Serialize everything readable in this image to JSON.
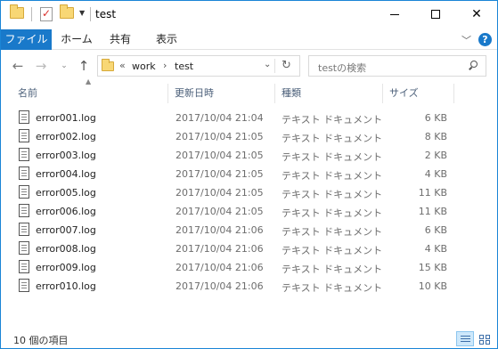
{
  "window": {
    "title": "test",
    "controls": {
      "minimize": "minimize",
      "maximize": "maximize",
      "close": "✕"
    }
  },
  "ribbon": {
    "tabs": [
      "ファイル",
      "ホーム",
      "共有",
      "表示"
    ],
    "expand_icon": "chevron-down-icon",
    "help": "?"
  },
  "address": {
    "overflow": "«",
    "crumbs": [
      "work",
      "test"
    ],
    "separator": "›"
  },
  "search": {
    "placeholder": "testの検索"
  },
  "columns": {
    "name": "名前",
    "date": "更新日時",
    "type": "種類",
    "size": "サイズ"
  },
  "files": [
    {
      "name": "error001.log",
      "date": "2017/10/04 21:04",
      "type": "テキスト ドキュメント",
      "size": "6 KB"
    },
    {
      "name": "error002.log",
      "date": "2017/10/04 21:05",
      "type": "テキスト ドキュメント",
      "size": "8 KB"
    },
    {
      "name": "error003.log",
      "date": "2017/10/04 21:05",
      "type": "テキスト ドキュメント",
      "size": "2 KB"
    },
    {
      "name": "error004.log",
      "date": "2017/10/04 21:05",
      "type": "テキスト ドキュメント",
      "size": "4 KB"
    },
    {
      "name": "error005.log",
      "date": "2017/10/04 21:05",
      "type": "テキスト ドキュメント",
      "size": "11 KB"
    },
    {
      "name": "error006.log",
      "date": "2017/10/04 21:05",
      "type": "テキスト ドキュメント",
      "size": "11 KB"
    },
    {
      "name": "error007.log",
      "date": "2017/10/04 21:06",
      "type": "テキスト ドキュメント",
      "size": "6 KB"
    },
    {
      "name": "error008.log",
      "date": "2017/10/04 21:06",
      "type": "テキスト ドキュメント",
      "size": "4 KB"
    },
    {
      "name": "error009.log",
      "date": "2017/10/04 21:06",
      "type": "テキスト ドキュメント",
      "size": "15 KB"
    },
    {
      "name": "error010.log",
      "date": "2017/10/04 21:06",
      "type": "テキスト ドキュメント",
      "size": "10 KB"
    }
  ],
  "status": {
    "item_count": "10 個の項目"
  },
  "colors": {
    "accent": "#1979ca",
    "header_text": "#4c607a",
    "folder": "#f8d775"
  }
}
